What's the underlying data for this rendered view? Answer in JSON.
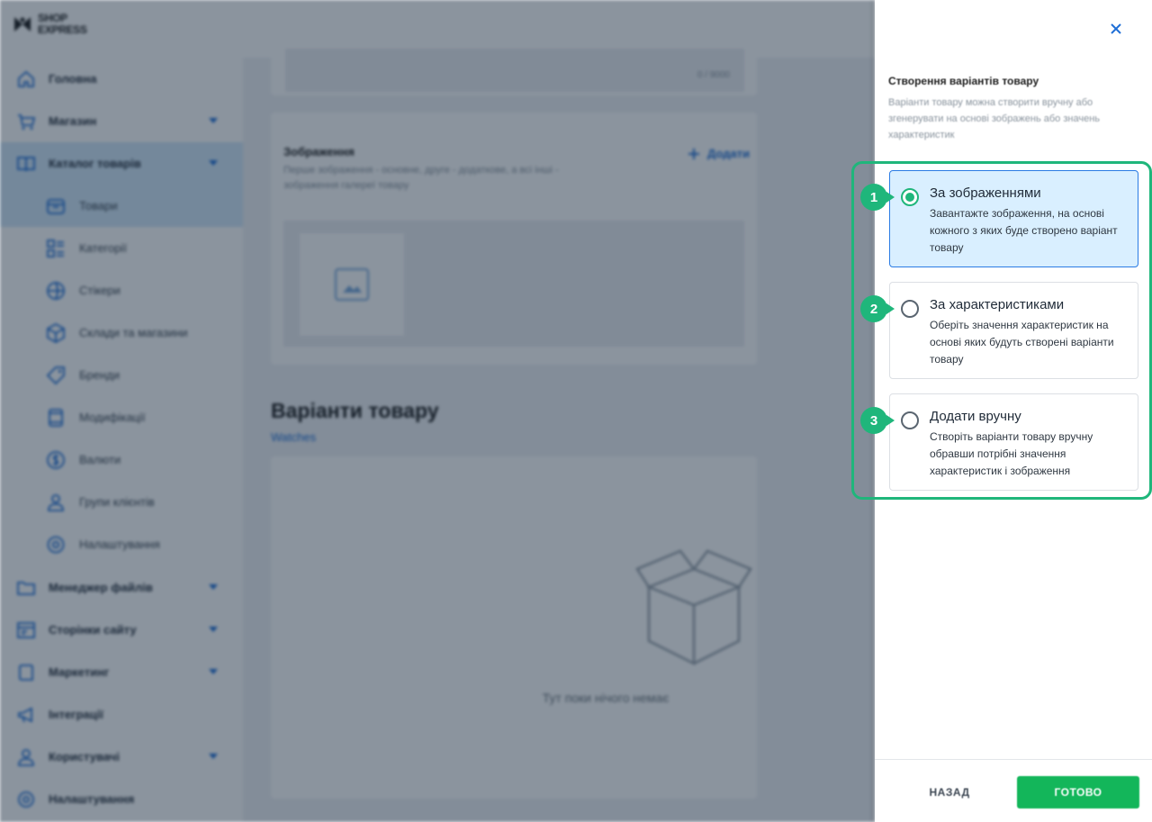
{
  "brand": {
    "line1": "SHOP",
    "line2": "EXPRESS"
  },
  "sidebar": {
    "items": [
      {
        "label": "Головна",
        "icon": "home-icon"
      },
      {
        "label": "Магазин",
        "icon": "cart-icon",
        "expandable": true
      },
      {
        "label": "Каталог товарів",
        "icon": "book-icon",
        "expandable": true,
        "active": true
      },
      {
        "label": "Товари",
        "icon": "box-icon",
        "sub": true,
        "active": true
      },
      {
        "label": "Категорії",
        "icon": "categories-icon",
        "sub": true
      },
      {
        "label": "Стікери",
        "icon": "sticker-icon",
        "sub": true
      },
      {
        "label": "Склади та магазини",
        "icon": "warehouse-icon",
        "sub": true
      },
      {
        "label": "Бренди",
        "icon": "tag-icon",
        "sub": true
      },
      {
        "label": "Модифікації",
        "icon": "modification-icon",
        "sub": true
      },
      {
        "label": "Валюти",
        "icon": "currency-icon",
        "sub": true
      },
      {
        "label": "Групи клієнтів",
        "icon": "user-group-icon",
        "sub": true
      },
      {
        "label": "Налаштування",
        "icon": "settings-icon",
        "sub": true
      },
      {
        "label": "Менеджер файлів",
        "icon": "folder-icon",
        "expandable": true
      },
      {
        "label": "Сторінки сайту",
        "icon": "pages-icon",
        "expandable": true
      },
      {
        "label": "Маркетинг",
        "icon": "marketing-icon",
        "expandable": true
      },
      {
        "label": "Інтеграції",
        "icon": "megaphone-icon"
      },
      {
        "label": "Користувачі",
        "icon": "users-icon",
        "expandable": true
      },
      {
        "label": "Налаштування",
        "icon": "gear-icon"
      }
    ]
  },
  "main": {
    "description_counter": "0 / 9000",
    "images_card": {
      "title": "Зображення",
      "description": "Перше зображення - основне, друге - додаткове, а всі інші - зображення галереї товару",
      "add_label": "Додати"
    },
    "variants_section": {
      "title": "Варіанти товару",
      "link": "Watches",
      "empty_text": "Тут поки нічого немає"
    }
  },
  "panel": {
    "title": "Створення варіантів товару",
    "description": "Варіанти товару можна створити вручну або згенерувати на основі зображень або значень характеристик",
    "options": [
      {
        "badge": "1",
        "title": "За зображеннями",
        "description": "Завантажте зображення, на основі кожного з яких буде створено варіант товару",
        "selected": true
      },
      {
        "badge": "2",
        "title": "За характеристиками",
        "description": "Оберіть значення характеристик на основі яких будуть створені варіанти товару",
        "selected": false
      },
      {
        "badge": "3",
        "title": "Додати вручну",
        "description": "Створіть варіанти товару вручну обравши потрібні значення характеристик і зображення",
        "selected": false
      }
    ],
    "back_label": "НАЗАД",
    "done_label": "ГОТОВО"
  },
  "colors": {
    "accent_green": "#1fb67b",
    "done_button": "#13b65a",
    "link_blue": "#1f6fd6",
    "selected_option_bg": "#d9efff"
  }
}
